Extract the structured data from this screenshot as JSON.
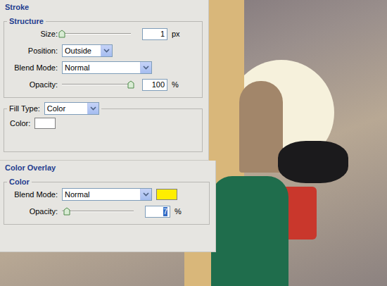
{
  "stroke": {
    "title": "Stroke",
    "structure": {
      "title": "Structure",
      "size": {
        "label": "Size:",
        "value": "1",
        "unit": "px",
        "level": 0.0,
        "selected": false
      },
      "position": {
        "label": "Position:",
        "value": "Outside"
      },
      "blend_mode": {
        "label": "Blend Mode:",
        "value": "Normal"
      },
      "opacity": {
        "label": "Opacity:",
        "value": "100",
        "unit": "%",
        "level": 1.0,
        "selected": false
      }
    },
    "fill": {
      "label": "Fill Type:",
      "value": "Color",
      "color_label": "Color:",
      "color": "#ffffff"
    }
  },
  "color_overlay": {
    "title": "Color Overlay",
    "group": "Color",
    "blend_mode": {
      "label": "Blend Mode:",
      "value": "Normal"
    },
    "color": "#ffee00",
    "opacity": {
      "label": "Opacity:",
      "value": "7",
      "unit": "%",
      "level": 0.07,
      "selected": true
    }
  }
}
